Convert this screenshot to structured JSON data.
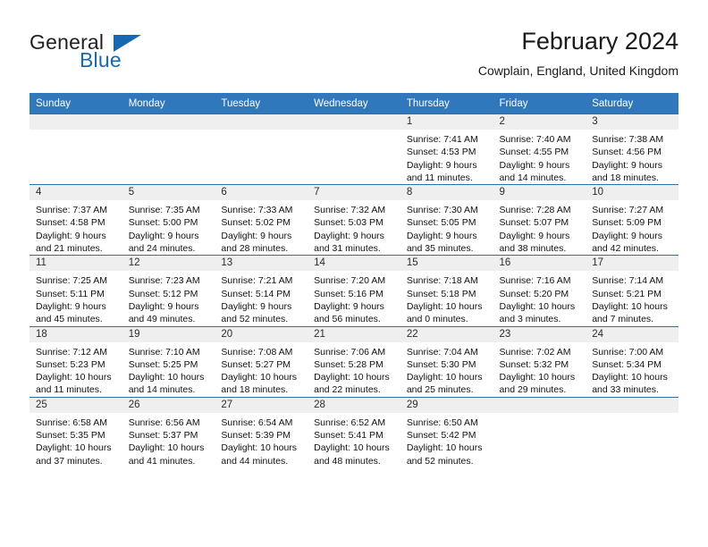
{
  "brand": {
    "name_top": "General",
    "name_bottom": "Blue",
    "accent_color": "#1569b4"
  },
  "header": {
    "title": "February 2024",
    "subtitle": "Cowplain, England, United Kingdom"
  },
  "theme": {
    "header_row_bg": "#3077bc",
    "daynum_band_bg": "#efefef",
    "row_divider": "#2f6fa8"
  },
  "weekday_headers": [
    "Sunday",
    "Monday",
    "Tuesday",
    "Wednesday",
    "Thursday",
    "Friday",
    "Saturday"
  ],
  "weeks": [
    [
      {
        "day": "",
        "empty": true
      },
      {
        "day": "",
        "empty": true
      },
      {
        "day": "",
        "empty": true
      },
      {
        "day": "",
        "empty": true
      },
      {
        "day": "1",
        "sunrise": "Sunrise: 7:41 AM",
        "sunset": "Sunset: 4:53 PM",
        "daylight_line1": "Daylight: 9 hours",
        "daylight_line2": "and 11 minutes."
      },
      {
        "day": "2",
        "sunrise": "Sunrise: 7:40 AM",
        "sunset": "Sunset: 4:55 PM",
        "daylight_line1": "Daylight: 9 hours",
        "daylight_line2": "and 14 minutes."
      },
      {
        "day": "3",
        "sunrise": "Sunrise: 7:38 AM",
        "sunset": "Sunset: 4:56 PM",
        "daylight_line1": "Daylight: 9 hours",
        "daylight_line2": "and 18 minutes."
      }
    ],
    [
      {
        "day": "4",
        "sunrise": "Sunrise: 7:37 AM",
        "sunset": "Sunset: 4:58 PM",
        "daylight_line1": "Daylight: 9 hours",
        "daylight_line2": "and 21 minutes."
      },
      {
        "day": "5",
        "sunrise": "Sunrise: 7:35 AM",
        "sunset": "Sunset: 5:00 PM",
        "daylight_line1": "Daylight: 9 hours",
        "daylight_line2": "and 24 minutes."
      },
      {
        "day": "6",
        "sunrise": "Sunrise: 7:33 AM",
        "sunset": "Sunset: 5:02 PM",
        "daylight_line1": "Daylight: 9 hours",
        "daylight_line2": "and 28 minutes."
      },
      {
        "day": "7",
        "sunrise": "Sunrise: 7:32 AM",
        "sunset": "Sunset: 5:03 PM",
        "daylight_line1": "Daylight: 9 hours",
        "daylight_line2": "and 31 minutes."
      },
      {
        "day": "8",
        "sunrise": "Sunrise: 7:30 AM",
        "sunset": "Sunset: 5:05 PM",
        "daylight_line1": "Daylight: 9 hours",
        "daylight_line2": "and 35 minutes."
      },
      {
        "day": "9",
        "sunrise": "Sunrise: 7:28 AM",
        "sunset": "Sunset: 5:07 PM",
        "daylight_line1": "Daylight: 9 hours",
        "daylight_line2": "and 38 minutes."
      },
      {
        "day": "10",
        "sunrise": "Sunrise: 7:27 AM",
        "sunset": "Sunset: 5:09 PM",
        "daylight_line1": "Daylight: 9 hours",
        "daylight_line2": "and 42 minutes."
      }
    ],
    [
      {
        "day": "11",
        "sunrise": "Sunrise: 7:25 AM",
        "sunset": "Sunset: 5:11 PM",
        "daylight_line1": "Daylight: 9 hours",
        "daylight_line2": "and 45 minutes."
      },
      {
        "day": "12",
        "sunrise": "Sunrise: 7:23 AM",
        "sunset": "Sunset: 5:12 PM",
        "daylight_line1": "Daylight: 9 hours",
        "daylight_line2": "and 49 minutes."
      },
      {
        "day": "13",
        "sunrise": "Sunrise: 7:21 AM",
        "sunset": "Sunset: 5:14 PM",
        "daylight_line1": "Daylight: 9 hours",
        "daylight_line2": "and 52 minutes."
      },
      {
        "day": "14",
        "sunrise": "Sunrise: 7:20 AM",
        "sunset": "Sunset: 5:16 PM",
        "daylight_line1": "Daylight: 9 hours",
        "daylight_line2": "and 56 minutes."
      },
      {
        "day": "15",
        "sunrise": "Sunrise: 7:18 AM",
        "sunset": "Sunset: 5:18 PM",
        "daylight_line1": "Daylight: 10 hours",
        "daylight_line2": "and 0 minutes."
      },
      {
        "day": "16",
        "sunrise": "Sunrise: 7:16 AM",
        "sunset": "Sunset: 5:20 PM",
        "daylight_line1": "Daylight: 10 hours",
        "daylight_line2": "and 3 minutes."
      },
      {
        "day": "17",
        "sunrise": "Sunrise: 7:14 AM",
        "sunset": "Sunset: 5:21 PM",
        "daylight_line1": "Daylight: 10 hours",
        "daylight_line2": "and 7 minutes."
      }
    ],
    [
      {
        "day": "18",
        "sunrise": "Sunrise: 7:12 AM",
        "sunset": "Sunset: 5:23 PM",
        "daylight_line1": "Daylight: 10 hours",
        "daylight_line2": "and 11 minutes."
      },
      {
        "day": "19",
        "sunrise": "Sunrise: 7:10 AM",
        "sunset": "Sunset: 5:25 PM",
        "daylight_line1": "Daylight: 10 hours",
        "daylight_line2": "and 14 minutes."
      },
      {
        "day": "20",
        "sunrise": "Sunrise: 7:08 AM",
        "sunset": "Sunset: 5:27 PM",
        "daylight_line1": "Daylight: 10 hours",
        "daylight_line2": "and 18 minutes."
      },
      {
        "day": "21",
        "sunrise": "Sunrise: 7:06 AM",
        "sunset": "Sunset: 5:28 PM",
        "daylight_line1": "Daylight: 10 hours",
        "daylight_line2": "and 22 minutes."
      },
      {
        "day": "22",
        "sunrise": "Sunrise: 7:04 AM",
        "sunset": "Sunset: 5:30 PM",
        "daylight_line1": "Daylight: 10 hours",
        "daylight_line2": "and 25 minutes."
      },
      {
        "day": "23",
        "sunrise": "Sunrise: 7:02 AM",
        "sunset": "Sunset: 5:32 PM",
        "daylight_line1": "Daylight: 10 hours",
        "daylight_line2": "and 29 minutes."
      },
      {
        "day": "24",
        "sunrise": "Sunrise: 7:00 AM",
        "sunset": "Sunset: 5:34 PM",
        "daylight_line1": "Daylight: 10 hours",
        "daylight_line2": "and 33 minutes."
      }
    ],
    [
      {
        "day": "25",
        "sunrise": "Sunrise: 6:58 AM",
        "sunset": "Sunset: 5:35 PM",
        "daylight_line1": "Daylight: 10 hours",
        "daylight_line2": "and 37 minutes."
      },
      {
        "day": "26",
        "sunrise": "Sunrise: 6:56 AM",
        "sunset": "Sunset: 5:37 PM",
        "daylight_line1": "Daylight: 10 hours",
        "daylight_line2": "and 41 minutes."
      },
      {
        "day": "27",
        "sunrise": "Sunrise: 6:54 AM",
        "sunset": "Sunset: 5:39 PM",
        "daylight_line1": "Daylight: 10 hours",
        "daylight_line2": "and 44 minutes."
      },
      {
        "day": "28",
        "sunrise": "Sunrise: 6:52 AM",
        "sunset": "Sunset: 5:41 PM",
        "daylight_line1": "Daylight: 10 hours",
        "daylight_line2": "and 48 minutes."
      },
      {
        "day": "29",
        "sunrise": "Sunrise: 6:50 AM",
        "sunset": "Sunset: 5:42 PM",
        "daylight_line1": "Daylight: 10 hours",
        "daylight_line2": "and 52 minutes."
      },
      {
        "day": "",
        "empty": true
      },
      {
        "day": "",
        "empty": true
      }
    ]
  ]
}
